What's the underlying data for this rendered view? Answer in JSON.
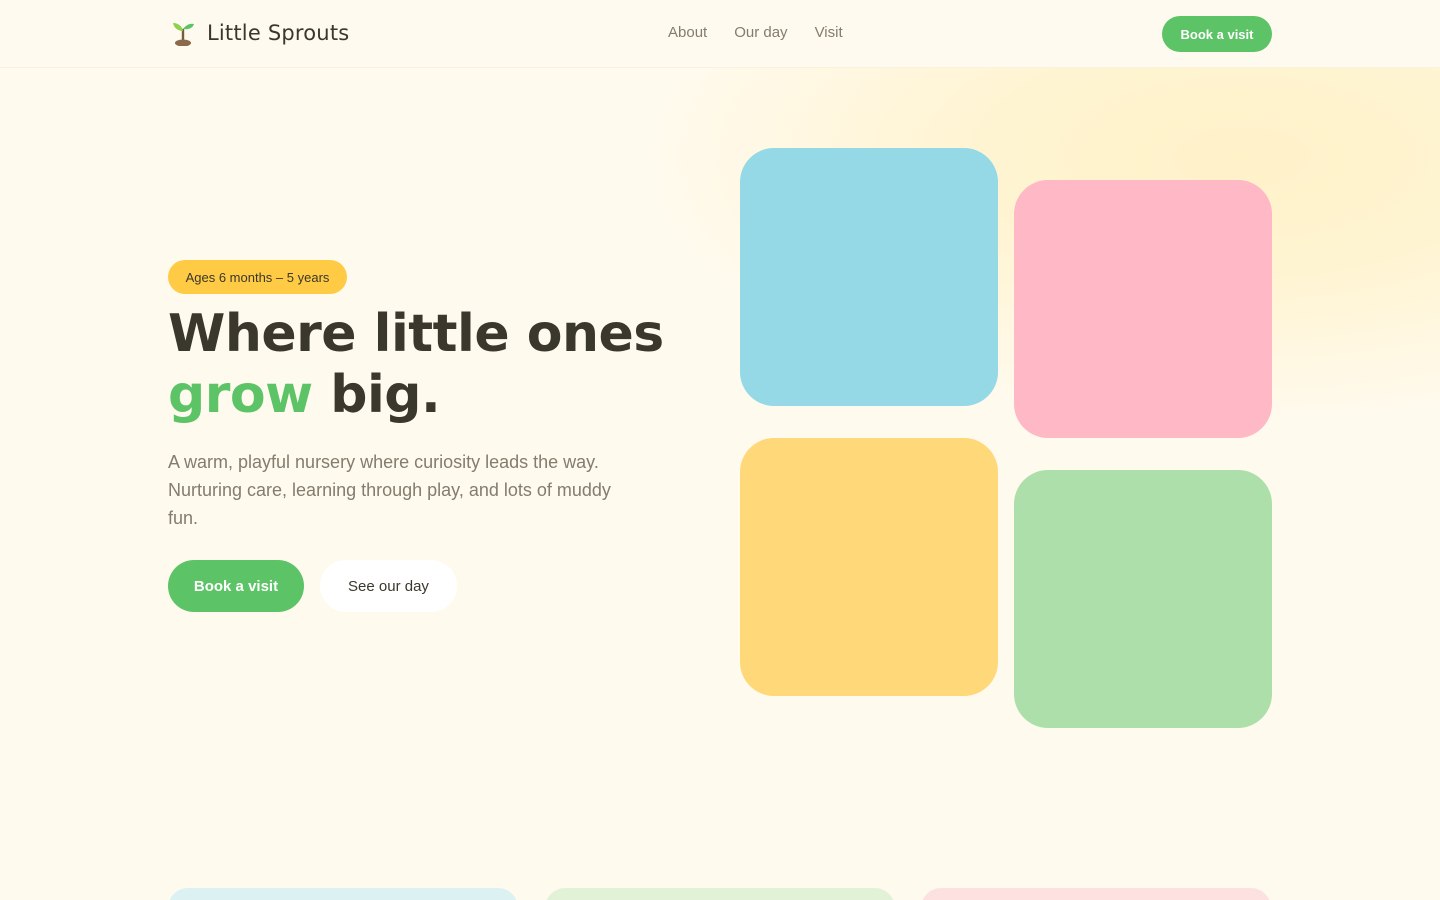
{
  "header": {
    "brand": {
      "name": "Little Sprouts",
      "logo_icon": "sprout-icon"
    },
    "nav": [
      {
        "label": "About"
      },
      {
        "label": "Our day"
      },
      {
        "label": "Visit"
      }
    ],
    "cta_label": "Book a visit"
  },
  "hero": {
    "badge": "Ages 6 months – 5 years",
    "headline_line1": "Where little ones",
    "headline_accent": "grow",
    "headline_end": " big.",
    "lede": "A warm, playful nursery where curiosity leads the way. Nurturing care, learning through play, and lots of muddy fun.",
    "primary_button": "Book a visit",
    "secondary_button": "See our day"
  },
  "tiles": [
    {
      "name": "blue",
      "color": "#95d9e6"
    },
    {
      "name": "pink",
      "color": "#ffb8c6"
    },
    {
      "name": "yellow",
      "color": "#ffd879"
    },
    {
      "name": "green",
      "color": "#addfab"
    }
  ],
  "cards_preview": [
    {
      "color": "#dcf1f1"
    },
    {
      "color": "#e2f2d7"
    },
    {
      "color": "#fde0e0"
    }
  ],
  "colors": {
    "background": "#fffaee",
    "brand_green": "#5cc466",
    "badge_yellow": "#ffcb45",
    "text_dark": "#3a372d",
    "text_muted": "#847c6d"
  }
}
